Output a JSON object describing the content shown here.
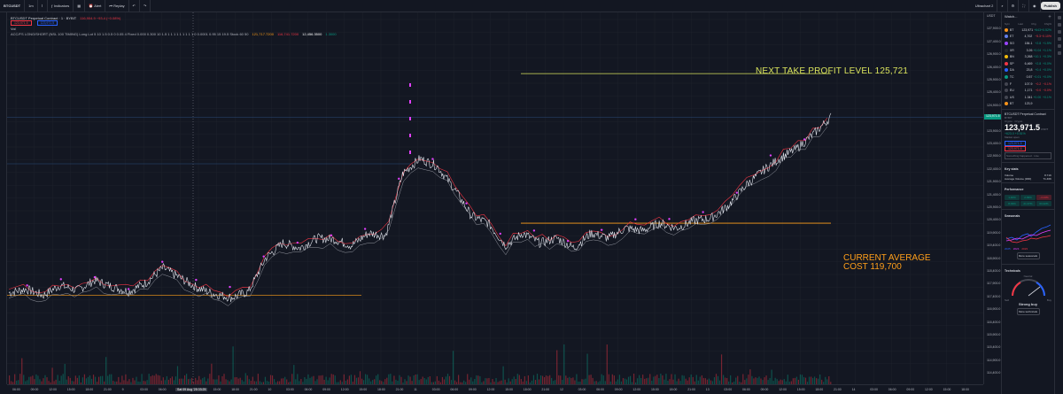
{
  "toolbar": {
    "symbol": "BTCUSDT",
    "interval": "1m",
    "indicators": "Indicators",
    "alert": "Alert",
    "replay": "Replay",
    "layout": "Ultrachart 2",
    "publish": "Publish"
  },
  "legend": {
    "title": "BTCUSDT Perpetual Contract · 1 · BYBIT",
    "ohlc": "116,904.9 −93.4 (−0.08%)",
    "badge1": "123,971.5",
    "badge2": "123,971.5",
    "vol": "Vol",
    "indicator_line": "ACC/FS LONG/SHORT (NSL 100 TIMING) Long Lot 5 10 1.5 0.5 0 0.05 4 Fixed 0.000 0.300 10 1.5 1 1 1 1 1 1 1 1 1 0 0.0001 0.95 15 19.5 Stock 60 50",
    "ind_val1": "121,717.7200",
    "ind_val2": "116,741.7200",
    "ind_val3": "12,456.3500",
    "ind_val4": "1.3000"
  },
  "annotations": {
    "take_profit": "NEXT TAKE PROFIT LEVEL 125,721",
    "avg_cost_line1": "CURRENT AVERAGE",
    "avg_cost_line2": "COST 119,700"
  },
  "chart_data": {
    "type": "line",
    "series": [
      {
        "name": "",
        "values": [
          116900,
          117050,
          116800,
          117200,
          117000,
          117400,
          117150,
          116950,
          117300,
          117900,
          117500,
          117100,
          116850,
          116700,
          116950,
          118300,
          118900,
          118700,
          119100,
          119050,
          118800,
          119300,
          119200,
          121700,
          122300,
          122000,
          121100,
          120000,
          119700,
          118800,
          119300,
          118900,
          119100,
          118700,
          119300,
          119100,
          119500,
          119400,
          119700,
          119500,
          119800,
          119900,
          120400,
          121200,
          121800,
          122300,
          122700,
          123300,
          123971
        ]
      }
    ],
    "ylim": [
      114000,
      127900
    ],
    "levels": [
      {
        "value": 125721,
        "color": "#d9e35c"
      },
      {
        "value": 119700,
        "color": "#ff9f1a"
      },
      {
        "value": 116800,
        "color": "#ff9f1a"
      }
    ],
    "last_price": "123,971.5"
  },
  "price_axis": {
    "labels": [
      "USDT",
      "127,900.0",
      "127,400.0",
      "126,900.0",
      "126,400.0",
      "125,900.0",
      "125,400.0",
      "124,900.0",
      "124,400.0",
      "123,900.0",
      "123,400.0",
      "122,900.0",
      "122,400.0",
      "121,900.0",
      "121,400.0",
      "120,900.0",
      "120,400.0",
      "119,900.0",
      "119,400.0",
      "118,900.0",
      "118,400.0",
      "117,900.0",
      "117,400.0",
      "116,900.0",
      "116,400.0",
      "115,900.0",
      "115,400.0",
      "114,900.0",
      "114,400.0"
    ],
    "current_tag": "123,971.5"
  },
  "time_axis": {
    "labels": [
      "06:00",
      "09:00",
      "12:00",
      "15:00",
      "18:00",
      "21:00",
      "9",
      "03:00",
      "06:00",
      "09:00",
      "12:00",
      "15:00",
      "18:00",
      "21:00",
      "10",
      "03:00",
      "06:00",
      "09:00",
      "12:00",
      "15:00",
      "18:00",
      "21:00",
      "11",
      "03:00",
      "06:00",
      "09:00",
      "12:00",
      "15:00",
      "18:00",
      "21:00",
      "12",
      "03:00",
      "06:00",
      "09:00",
      "12:00",
      "15:00",
      "18:00",
      "21:00",
      "13",
      "03:00",
      "06:00",
      "09:00",
      "12:00",
      "15:00",
      "18:00",
      "21:00",
      "14",
      "03:00",
      "06:00",
      "09:00",
      "12:00",
      "15:00",
      "18:00"
    ],
    "cursor_label": "Sat 09 Aug '25  03:25"
  },
  "watchlist": {
    "title": "Watch...",
    "cols": [
      "Sym",
      "Last",
      "Chg",
      "Chg%"
    ],
    "rows": [
      {
        "sym": "BT",
        "last": "123,971",
        "chg": "+643",
        "pct": "+0.52%",
        "color": "#f7931a",
        "dir": "pos"
      },
      {
        "sym": "ET",
        "last": "4,702",
        "chg": "−5.3",
        "pct": "−0.10%",
        "color": "#627eea",
        "dir": "neg"
      },
      {
        "sym": "SO",
        "last": "184.1",
        "chg": "+2.8",
        "pct": "+1.5%",
        "color": "#9945ff",
        "dir": "pos"
      },
      {
        "sym": "XR",
        "last": "3.26",
        "chg": "+0.04",
        "pct": "+1.1%",
        "color": "#23292f",
        "dir": "pos"
      },
      {
        "sym": "BN",
        "last": "3,268",
        "chg": "+10.1",
        "pct": "+0.3%",
        "color": "#f0b90b",
        "dir": "pos"
      },
      {
        "sym": "SP",
        "last": "6,469",
        "chg": "+2.8",
        "pct": "+0.0%",
        "color": "#f23645",
        "dir": "pos"
      },
      {
        "sym": "DA",
        "last": "23,8",
        "chg": "+0.4",
        "pct": "+0.0%",
        "color": "#2962ff",
        "dir": "pos"
      },
      {
        "sym": "TC",
        "last": "0.57",
        "chg": "−0.01",
        "pct": "+0.0%",
        "color": "#089981",
        "dir": "pos"
      },
      {
        "sym": "F",
        "last": "107.9",
        "chg": "−0.2",
        "pct": "−0.1%",
        "color": "#434651",
        "dir": "neg"
      },
      {
        "sym": "EU",
        "last": "1,171",
        "chg": "−0.0",
        "pct": "−0.0%",
        "color": "#434651",
        "dir": "neg"
      },
      {
        "sym": "US",
        "last": "1.341",
        "chg": "+0.00",
        "pct": "+0.1%",
        "color": "#434651",
        "dir": "pos"
      },
      {
        "sym": "BT",
        "last": "123,9",
        "chg": "",
        "pct": "",
        "color": "#f7931a",
        "dir": "pos"
      }
    ]
  },
  "details": {
    "name": "BTCUSDT Perpetual Contract",
    "exchange": "BYBIT",
    "type": "Crypto · Crypto",
    "price": "123,971.5",
    "currency": "USDT",
    "change": "+623.0 +0.51%",
    "status": "Market open",
    "bid": "123,971.5",
    "ask": "123,971.6",
    "note": "Something happened · Live"
  },
  "key_stats": {
    "title": "Key stats",
    "volume_label": "Volume",
    "volume": "8.71K",
    "avg_label": "Average Volume (30D)",
    "avg": "71.46K"
  },
  "performance": {
    "title": "Performance",
    "cells": [
      "1.40%",
      "2.09%",
      "−4.13%",
      "8.03%",
      "21.37%",
      "63.42%"
    ],
    "signs": [
      "p",
      "p",
      "n",
      "p",
      "p",
      "p"
    ]
  },
  "seasonals": {
    "title": "Seasonals",
    "legend": [
      "2025",
      "2024",
      "2023"
    ],
    "button": "More seasonals"
  },
  "technicals": {
    "title": "Technicals",
    "label": "Neutral",
    "sell": "Sell",
    "buy": "Buy",
    "rating": "Strong buy",
    "button": "More technicals"
  },
  "colors": {
    "up": "#089981",
    "down": "#f23645",
    "bg": "#131722",
    "grid": "#1e222d"
  }
}
